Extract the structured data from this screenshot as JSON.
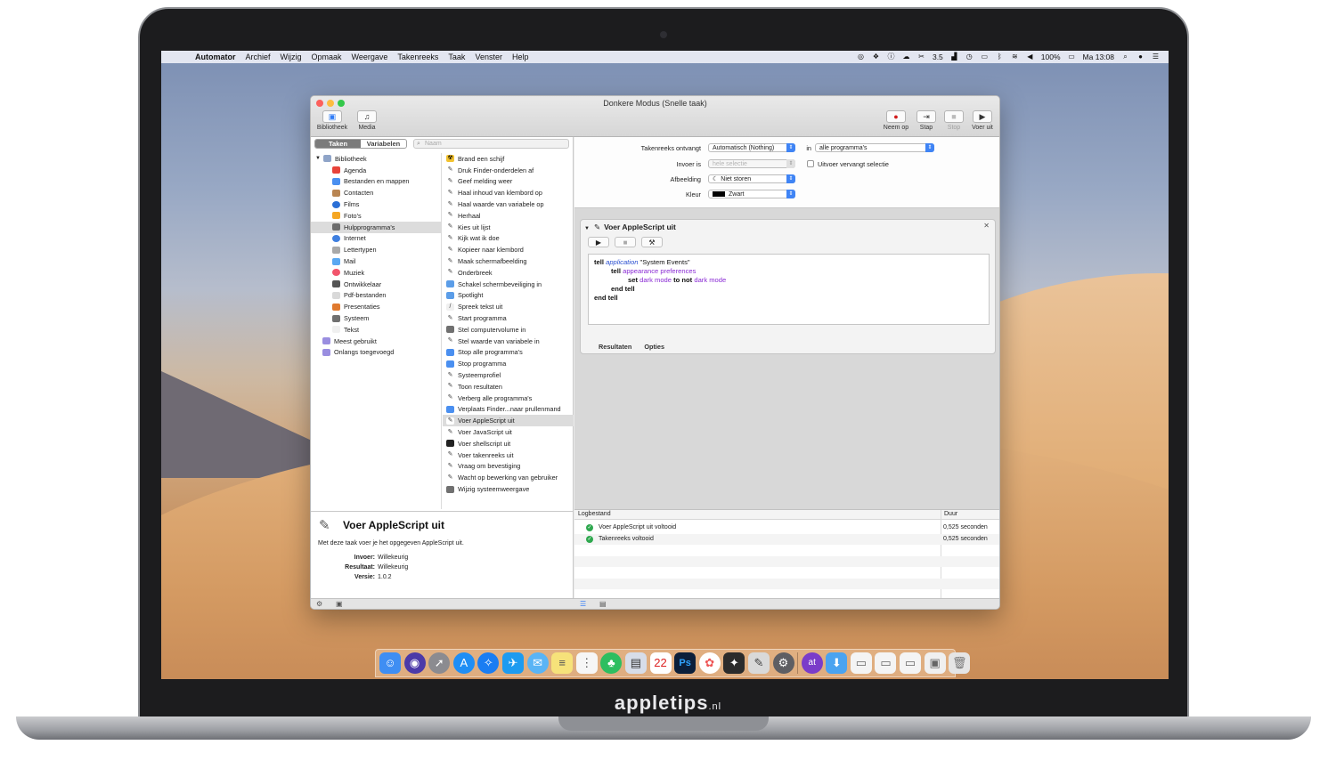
{
  "menubar": {
    "apple": "",
    "items": [
      "Automator",
      "Archief",
      "Wijzig",
      "Opmaak",
      "Weergave",
      "Takenreeks",
      "Taak",
      "Venster",
      "Help"
    ],
    "status_number": "3.5",
    "battery": "100%",
    "clock": "Ma 13:08"
  },
  "window": {
    "title": "Donkere Modus (Snelle taak)",
    "toolbar": {
      "library": "Bibliotheek",
      "media": "Media",
      "record": "Neem op",
      "step": "Stap",
      "stop": "Stop",
      "run": "Voer uit"
    },
    "segment": {
      "actions": "Taken",
      "variables": "Variabelen"
    },
    "search_placeholder": "Naam",
    "library": [
      "Bibliotheek",
      "Agenda",
      "Bestanden en mappen",
      "Contacten",
      "Films",
      "Foto's",
      "Hulpprogramma's",
      "Internet",
      "Lettertypen",
      "Mail",
      "Muziek",
      "Ontwikkelaar",
      "Pdf-bestanden",
      "Presentaties",
      "Systeem",
      "Tekst",
      "Meest gebruikt",
      "Onlangs toegevoegd"
    ],
    "actions": [
      "Brand een schijf",
      "Druk Finder-onderdelen af",
      "Geef melding weer",
      "Haal inhoud van klembord op",
      "Haal waarde van variabele op",
      "Herhaal",
      "Kies uit lijst",
      "Kijk wat ik doe",
      "Kopieer naar klembord",
      "Maak schermafbeelding",
      "Onderbreek",
      "Schakel schermbeveiliging in",
      "Spotlight",
      "Spreek tekst uit",
      "Start programma",
      "Stel computervolume in",
      "Stel waarde van variabele in",
      "Stop alle programma's",
      "Stop programma",
      "Systeemprofiel",
      "Toon resultaten",
      "Verberg alle programma's",
      "Verplaats Finder...naar prullenmand",
      "Voer AppleScript uit",
      "Voer JavaScript uit",
      "Voer shellscript uit",
      "Voer takenreeks uit",
      "Vraag om bevestiging",
      "Wacht op bewerking van gebruiker",
      "Wijzig systeemweergave"
    ],
    "description": {
      "title": "Voer AppleScript uit",
      "text": "Met deze taak voer je het opgegeven AppleScript uit.",
      "input_label": "Invoer:",
      "input_value": "Willekeurig",
      "result_label": "Resultaat:",
      "result_value": "Willekeurig",
      "version_label": "Versie:",
      "version_value": "1.0.2"
    },
    "workflow_props": {
      "receives_label": "Takenreeks ontvangt",
      "receives_value": "Automatisch (Nothing)",
      "in_label": "in",
      "in_value": "alle programma's",
      "input_label": "Invoer is",
      "input_value": "hele selectie",
      "replace_label": "Uitvoer vervangt selectie",
      "image_label": "Afbeelding",
      "image_value": "Niet storen",
      "color_label": "Kleur",
      "color_value": "Zwart"
    },
    "action_block": {
      "title": "Voer AppleScript uit",
      "results_tab": "Resultaten",
      "options_tab": "Opties",
      "code": {
        "l1_kw": "tell",
        "l1_app": "application",
        "l1_str": "\"System Events\"",
        "l2_kw": "tell",
        "l2_val": "appearance preferences",
        "l3_kw": "set",
        "l3_val": "dark mode",
        "l3_to": "to not",
        "l3_val2": "dark mode",
        "l4": "end tell",
        "l5": "end tell"
      }
    },
    "log": {
      "col_log": "Logbestand",
      "col_duration": "Duur",
      "rows": [
        {
          "text": "Voer AppleScript uit voltooid",
          "duration": "0,525 seconden"
        },
        {
          "text": "Takenreeks voltooid",
          "duration": "0,525 seconden"
        }
      ]
    }
  },
  "brand": {
    "name": "appletips",
    "tld": ".nl"
  },
  "colors": {
    "accent": "#3f84f5",
    "ok": "#2fa84f",
    "applescript_value": "#8a2bd4"
  }
}
